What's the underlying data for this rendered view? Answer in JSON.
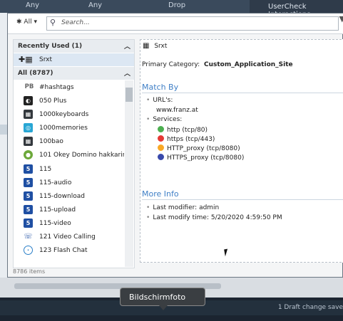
{
  "background": {
    "tabs": [
      "Any",
      "Any",
      "Drop"
    ],
    "right_title": "UserCheck Interactions",
    "status_text": "1 Draft change save"
  },
  "topbar": {
    "all_label": "All",
    "search_placeholder": "Search..."
  },
  "left": {
    "recent_header": "Recently Used (1)",
    "recent_items": [
      "Srxt"
    ],
    "all_header": "All (8787)",
    "items": [
      {
        "label": "#hashtags",
        "icon": "pb-icon"
      },
      {
        "label": "050 Plus",
        "icon": "robot-icon"
      },
      {
        "label": "1000keyboards",
        "icon": "grid-icon"
      },
      {
        "label": "1000memories",
        "icon": "memories-icon"
      },
      {
        "label": "100bao",
        "icon": "grid-icon"
      },
      {
        "label": "101 Okey Domino hakkarim.n",
        "icon": "globe-icon"
      },
      {
        "label": "115",
        "icon": "five-icon"
      },
      {
        "label": "115-audio",
        "icon": "five-icon"
      },
      {
        "label": "115-download",
        "icon": "five-icon"
      },
      {
        "label": "115-upload",
        "icon": "five-icon"
      },
      {
        "label": "115-video",
        "icon": "five-icon"
      },
      {
        "label": "121 Video Calling",
        "icon": "video-icon"
      },
      {
        "label": "123 Flash Chat",
        "icon": "chat-bubble-icon"
      }
    ],
    "count_text": "8786 items"
  },
  "detail": {
    "name": "Srxt",
    "primary_category_label": "Primary Category:",
    "primary_category_value": "Custom_Application_Site",
    "match_by_title": "Match By",
    "urls_label": "URL's:",
    "url_value": "www.franz.at",
    "services_label": "Services:",
    "services": [
      {
        "label": "http (tcp/80)",
        "color": "#4caf50"
      },
      {
        "label": "https (tcp/443)",
        "color": "#e53935"
      },
      {
        "label": "HTTP_proxy (tcp/8080)",
        "color": "#f9a825"
      },
      {
        "label": "HTTPS_proxy (tcp/8080)",
        "color": "#3949ab"
      }
    ],
    "more_info_title": "More Info",
    "last_modifier_label": "Last modifier:",
    "last_modifier_value": "admin",
    "last_modify_time_label": "Last modify time:",
    "last_modify_time_value": "5/20/2020 4:59:50 PM"
  },
  "tooltip": "Bildschirmfoto"
}
